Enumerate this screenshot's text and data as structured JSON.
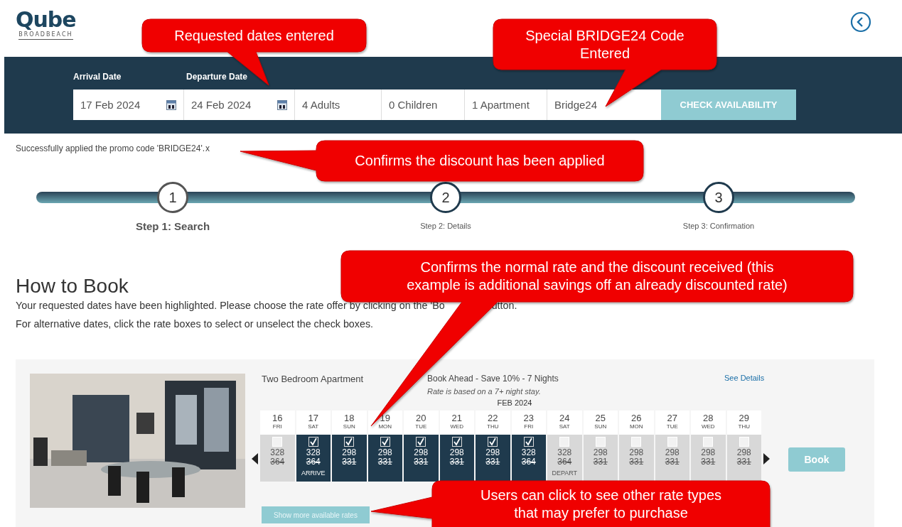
{
  "header": {
    "logo": "Qube",
    "tagline": "BROADBEACH"
  },
  "search": {
    "labels": [
      "Arrival Date",
      "Departure Date"
    ],
    "fields": [
      {
        "kind": "date",
        "value": "17 Feb 2024"
      },
      {
        "kind": "date",
        "value": "24 Feb 2024"
      },
      {
        "kind": "select",
        "value": "4 Adults"
      },
      {
        "kind": "select",
        "value": "0 Children"
      },
      {
        "kind": "select",
        "value": "1 Apartment"
      },
      {
        "kind": "text",
        "value": "Bridge24"
      }
    ],
    "button": "CHECK AVAILABILITY"
  },
  "promo_message": {
    "text": "Successfully applied the promo code 'BRIDGE24'.",
    "close": "x"
  },
  "steps": [
    {
      "number": "1",
      "label": "Step 1: Search",
      "selected": true
    },
    {
      "number": "2",
      "label": "Step 2: Details",
      "selected": false
    },
    {
      "number": "3",
      "label": "Step 3: Confirmation",
      "selected": false
    }
  ],
  "how_to_book": {
    "title": "How to Book",
    "line_1_start": "Your requested dates have been highlighted. Please choose the rate offer by clicking on the 'Bo",
    "line_1_end": "utton.",
    "line_2": "For alternative dates, click the rate boxes to select or unselect the check boxes."
  },
  "room": {
    "name": "Two Bedroom Apartment",
    "rate_name": "Book Ahead - Save 10% - 7 Nights",
    "rate_note": "Rate is based on a 7+ night stay.",
    "details_link": "See Details",
    "month": "FEB 2024",
    "days": [
      {
        "day": "16",
        "weekday": "FRI",
        "selected": false,
        "rate": "328",
        "was": "364"
      },
      {
        "day": "17",
        "weekday": "SAT",
        "selected": true,
        "rate": "328",
        "was": "364",
        "note": "ARRIVE"
      },
      {
        "day": "18",
        "weekday": "SUN",
        "selected": true,
        "rate": "298",
        "was": "331"
      },
      {
        "day": "19",
        "weekday": "MON",
        "selected": true,
        "rate": "298",
        "was": "331"
      },
      {
        "day": "20",
        "weekday": "TUE",
        "selected": true,
        "rate": "298",
        "was": "331"
      },
      {
        "day": "21",
        "weekday": "WED",
        "selected": true,
        "rate": "298",
        "was": "331"
      },
      {
        "day": "22",
        "weekday": "THU",
        "selected": true,
        "rate": "298",
        "was": "331"
      },
      {
        "day": "23",
        "weekday": "FRI",
        "selected": true,
        "rate": "328",
        "was": "364"
      },
      {
        "day": "24",
        "weekday": "SAT",
        "selected": false,
        "rate": "328",
        "was": "364",
        "note": "DEPART"
      },
      {
        "day": "25",
        "weekday": "SUN",
        "selected": false,
        "rate": "298",
        "was": "331"
      },
      {
        "day": "26",
        "weekday": "MON",
        "selected": false,
        "rate": "298",
        "was": "331"
      },
      {
        "day": "27",
        "weekday": "TUE",
        "selected": false,
        "rate": "298",
        "was": "331"
      },
      {
        "day": "28",
        "weekday": "WED",
        "selected": false,
        "rate": "298",
        "was": "331"
      },
      {
        "day": "29",
        "weekday": "THU",
        "selected": false,
        "rate": "298",
        "was": "331"
      }
    ],
    "book_button": "Book",
    "more_rates_button": "Show more available rates"
  },
  "callouts": [
    {
      "lines": [
        "Requested dates entered"
      ]
    },
    {
      "lines": [
        "Special BRIDGE24 Code",
        "Entered"
      ]
    },
    {
      "lines": [
        "Confirms the discount has been applied"
      ]
    },
    {
      "lines": [
        "Confirms the normal rate and the discount received (this",
        "example is additional savings off an already discounted rate)"
      ]
    },
    {
      "lines": [
        "Users can click to see other rate types",
        "that may prefer to purchase"
      ]
    }
  ]
}
